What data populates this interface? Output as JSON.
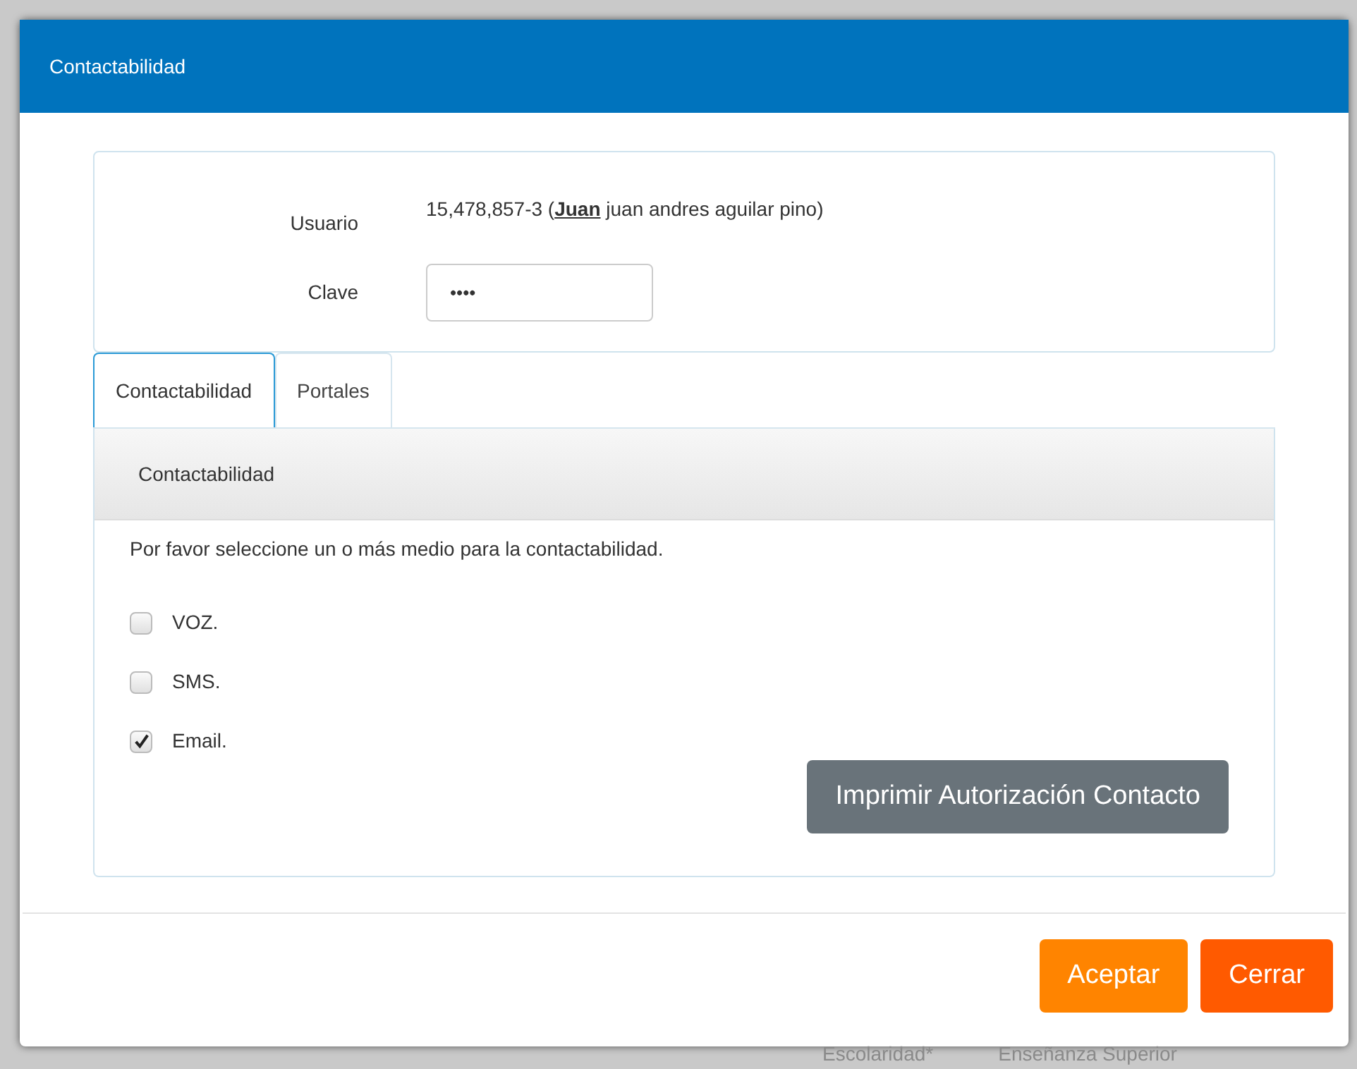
{
  "dialog": {
    "title": "Contactabilidad"
  },
  "user": {
    "label": "Usuario",
    "value": "15,478,857-3 (**Juan** juan andres aguilar pino)"
  },
  "password": {
    "label": "Clave",
    "value": "••••"
  },
  "tabs": [
    {
      "label": "Contactabilidad",
      "selected": true
    },
    {
      "label": "Portales",
      "selected": false
    }
  ],
  "panel": {
    "heading": "Contactabilidad",
    "instruction": "Por favor seleccione un o más medio para la contactabilidad.",
    "options": [
      {
        "label": "VOZ.",
        "checked": false
      },
      {
        "label": "SMS.",
        "checked": false
      },
      {
        "label": "Email.",
        "checked": true
      }
    ],
    "print_button": "Imprimir Autorización Contacto"
  },
  "buttons": [
    {
      "label": "Aceptar",
      "kind": "primary"
    },
    {
      "label": "Cerrar",
      "kind": "danger"
    }
  ],
  "background_form": [
    "Escolaridad*",
    "Enseñanza Superior"
  ]
}
